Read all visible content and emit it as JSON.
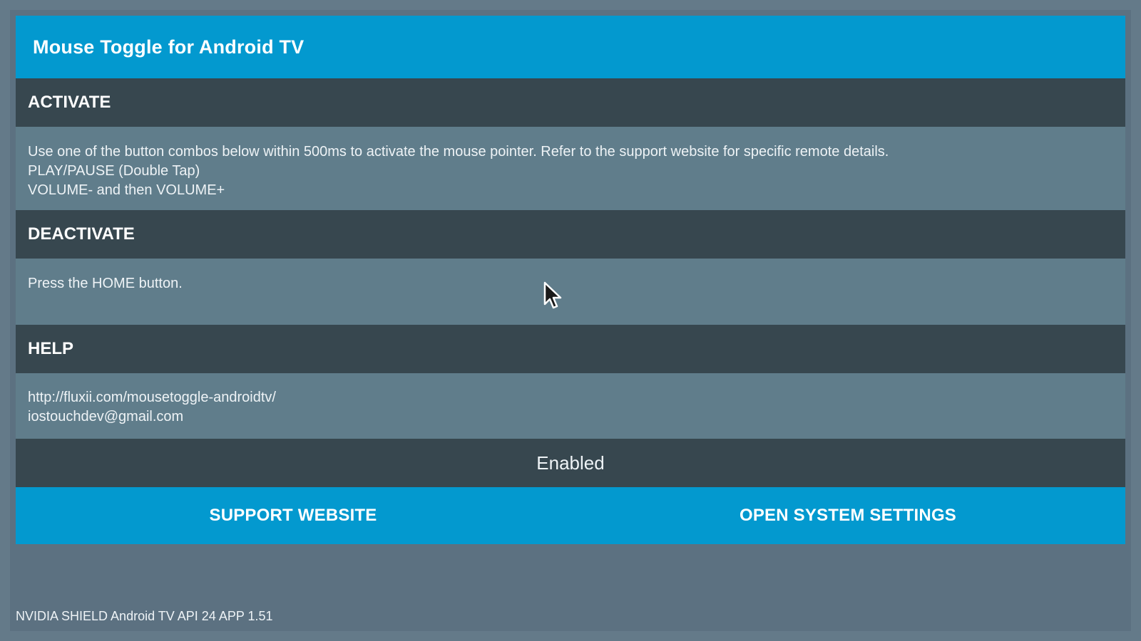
{
  "app": {
    "title": "Mouse Toggle for Android TV"
  },
  "sections": {
    "activate": {
      "header": "ACTIVATE",
      "lines": [
        "Use one of the button combos below within 500ms to activate the mouse pointer. Refer to the support website for specific remote details.",
        "PLAY/PAUSE (Double Tap)",
        "VOLUME- and then VOLUME+"
      ]
    },
    "deactivate": {
      "header": "DEACTIVATE",
      "lines": [
        "Press the HOME button."
      ]
    },
    "help": {
      "header": "HELP",
      "lines": [
        "http://fluxii.com/mousetoggle-androidtv/",
        "iostouchdev@gmail.com"
      ]
    }
  },
  "status": {
    "label": "Enabled"
  },
  "buttons": {
    "support_website": "SUPPORT WEBSITE",
    "open_system_settings": "OPEN SYSTEM SETTINGS"
  },
  "footer": {
    "device_info": "NVIDIA SHIELD Android TV API 24 APP 1.51"
  },
  "icons": {
    "cursor": "mouse-pointer-icon"
  },
  "colors": {
    "accent": "#0399cf",
    "header_bg": "#37474f",
    "body_bg": "#607d8b",
    "frame_bg": "#5c7181"
  }
}
